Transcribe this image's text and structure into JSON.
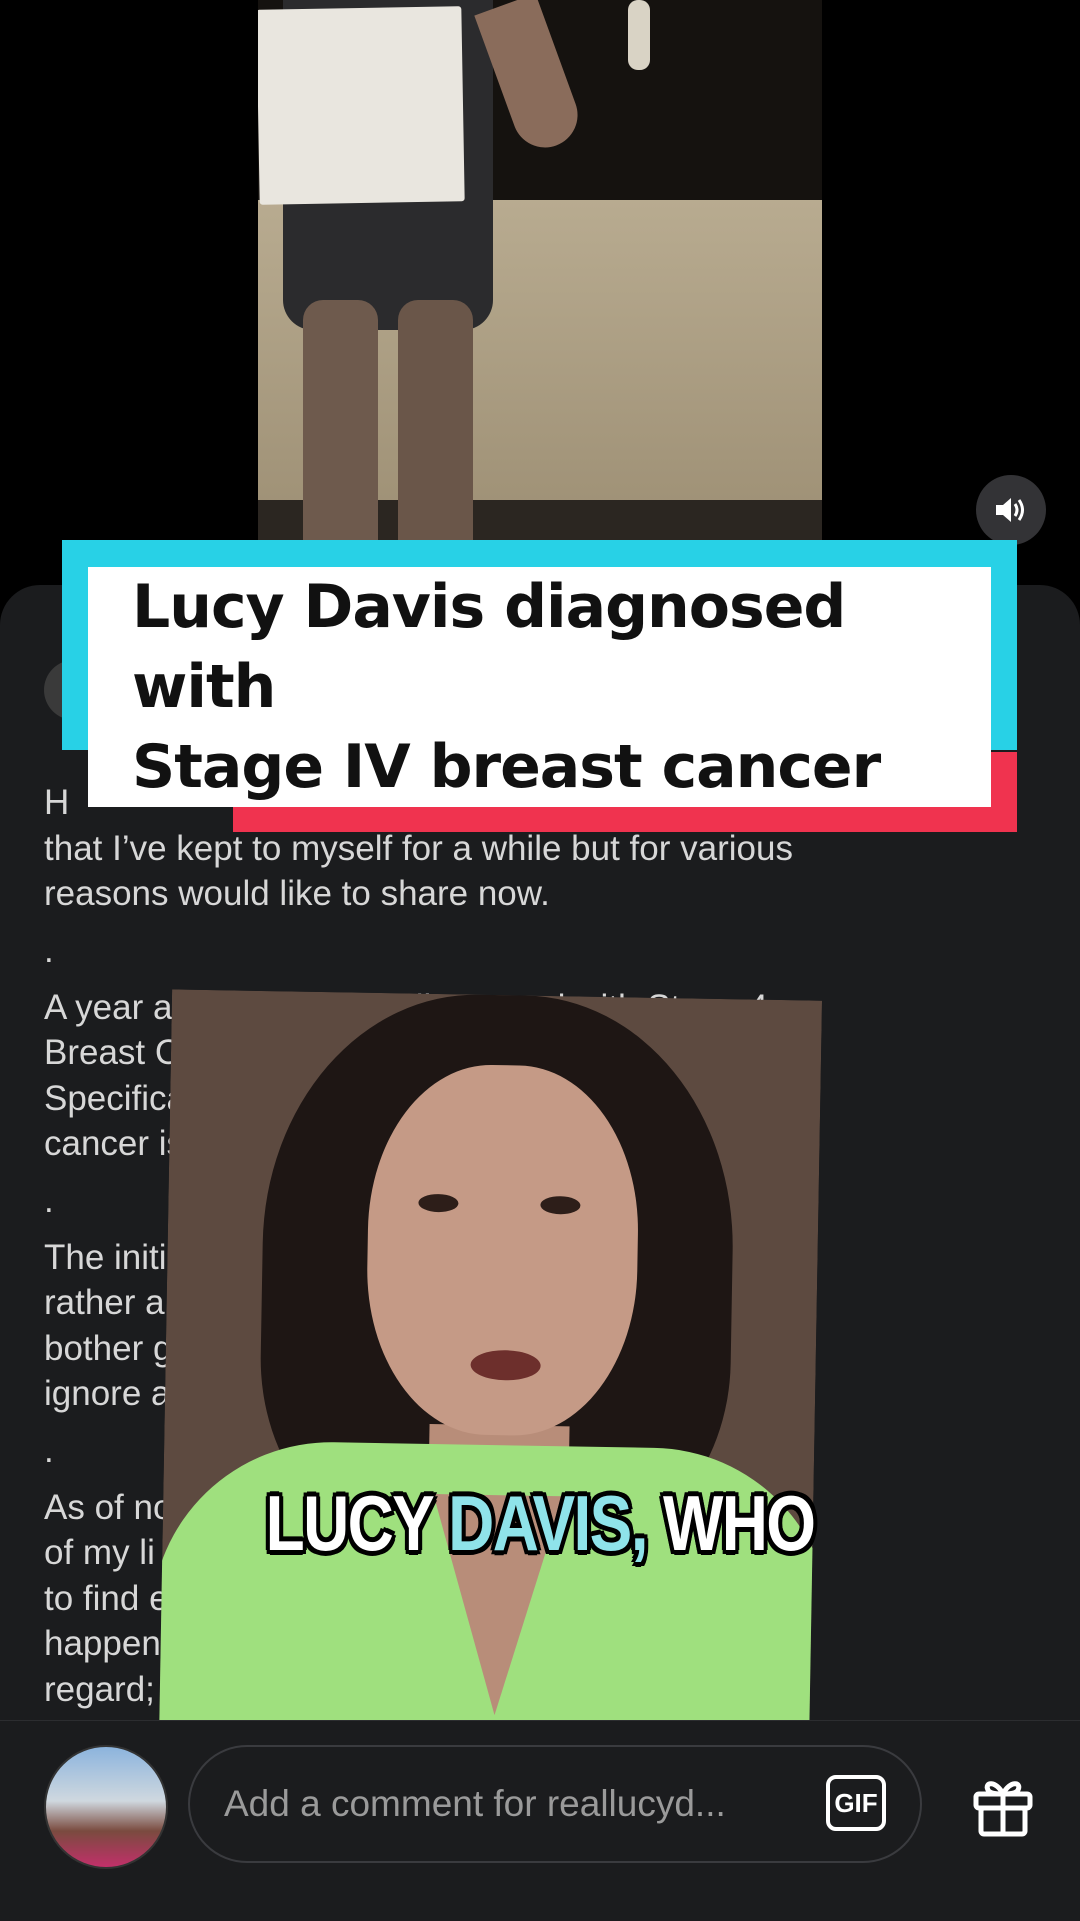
{
  "headline": {
    "line1": "Lucy Davis diagnosed with",
    "line2": "Stage IV breast cancer"
  },
  "post": {
    "paragraphs": [
      "H",
      "that I’ve kept to myself for a while but for various",
      "reasons would like to share now.",
      ".",
      "A year and a half ago I     diagnosed with Stage 4",
      "Breast Cancer, which          sized to my bones.",
      "Specifically to my                  and my ribs. The",
      "cancer is incura                     chemo.",
      ".",
      "The initial lum                        p’ as such;",
      "rather a kind                          lmost didn’t",
      "bother getting                        saying don’t",
      "ignore anythi                         out:)",
      ".",
      "As of no                                  ght be left",
      "of my li                                   always like",
      "to find                                     egative that",
      "happen                                     in that",
      "regard;                                     and I’m"
    ]
  },
  "caption": {
    "word1": "LUCY",
    "word2": "DAVIS,",
    "word3": "WHO"
  },
  "comment_bar": {
    "placeholder": "Add a comment for reallucyd...",
    "gif_label": "GIF"
  },
  "icons": {
    "speaker": "speaker-volume-icon",
    "gift": "gift-icon"
  },
  "colors": {
    "headline_cyan": "#28d1e6",
    "headline_red": "#f0334f",
    "caption_highlight": "#8fe3ea"
  }
}
